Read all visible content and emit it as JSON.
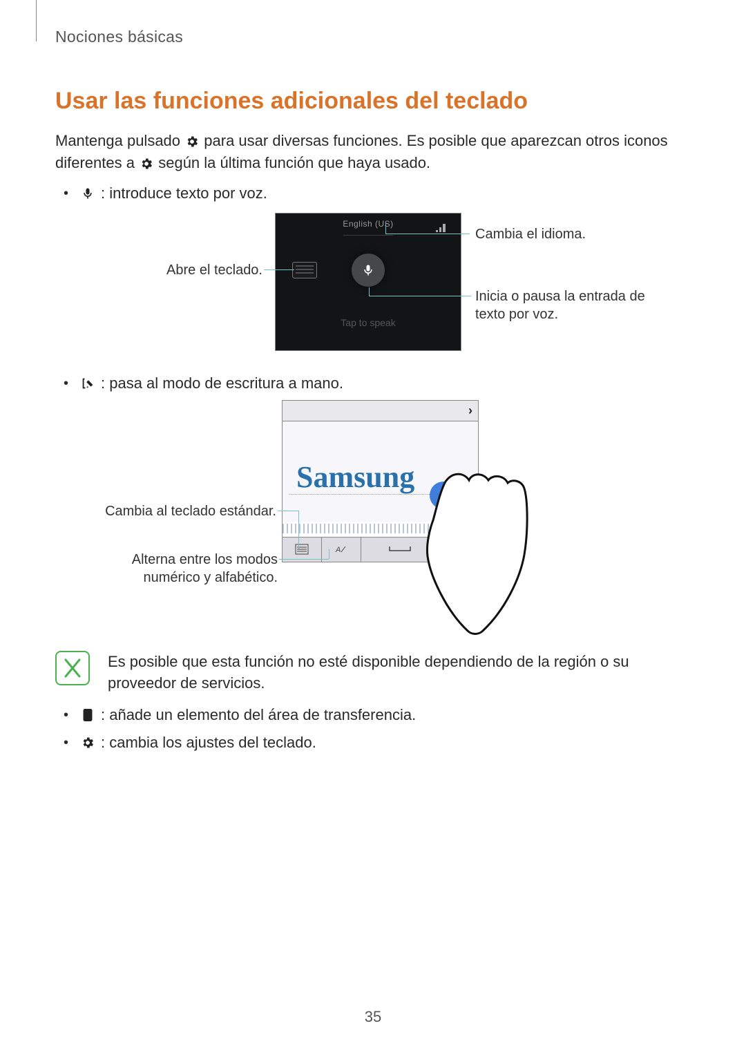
{
  "header": {
    "section": "Nociones básicas"
  },
  "title": "Usar las funciones adicionales del teclado",
  "intro": {
    "part1": "Mantenga pulsado",
    "part2": "para usar diversas funciones. Es posible que aparezcan otros iconos diferentes a",
    "part3": "según la última función que haya usado."
  },
  "bullets": {
    "voice": ": introduce texto por voz.",
    "handwriting": ": pasa al modo de escritura a mano.",
    "clipboard": ": añade un elemento del área de transferencia.",
    "settings": ": cambia los ajustes del teclado."
  },
  "fig1": {
    "open_keyboard": "Abre el teclado.",
    "change_language": "Cambia el idioma.",
    "start_pause_voice": "Inicia o pausa la entrada de texto por voz.",
    "lang_hint": "English (US)",
    "tap_to_speak": "Tap to speak"
  },
  "fig2": {
    "standard_keyboard": "Cambia al teclado estándar.",
    "toggle_modes": "Alterna entre los modos numérico y alfabético.",
    "sample_word": "Samsung"
  },
  "note": "Es posible que esta función no esté disponible dependiendo de la región o su proveedor de servicios.",
  "page_number": "35"
}
